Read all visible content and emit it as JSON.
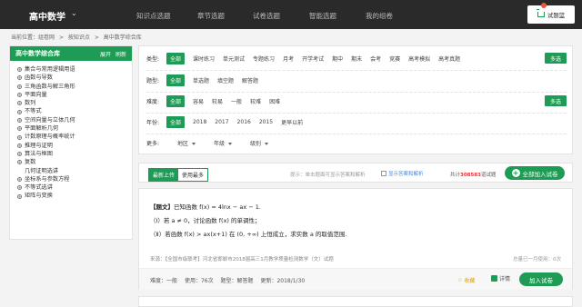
{
  "header": {
    "brand": "高中数学",
    "nav": [
      "知识点选题",
      "章节选题",
      "试卷选题",
      "智能选题",
      "我的组卷"
    ],
    "basket_label": "试题篮"
  },
  "breadcrumb": [
    "当前位置：组卷网",
    ">",
    "按知识点",
    ">",
    "高中数学综合库"
  ],
  "sidebar": {
    "title": "高中数学综合库",
    "expand_label": "展开",
    "refresh_label": "刷新",
    "items": [
      {
        "label": "集合与常用逻辑用语",
        "child": false
      },
      {
        "label": "函数与导数",
        "child": false
      },
      {
        "label": "三角函数与解三角形",
        "child": false
      },
      {
        "label": "平面向量",
        "child": false
      },
      {
        "label": "数列",
        "child": false
      },
      {
        "label": "不等式",
        "child": false
      },
      {
        "label": "空间向量与立体几何",
        "child": false
      },
      {
        "label": "平面解析几何",
        "child": false
      },
      {
        "label": "计数原理与概率统计",
        "child": false
      },
      {
        "label": "推理与证明",
        "child": false
      },
      {
        "label": "算法与框图",
        "child": false
      },
      {
        "label": "复数",
        "child": false
      },
      {
        "label": "几何证明选讲",
        "child": true
      },
      {
        "label": "坐标系与参数方程",
        "child": false
      },
      {
        "label": "不等式选讲",
        "child": false
      },
      {
        "label": "矩阵与变换",
        "child": false
      }
    ]
  },
  "filters": {
    "type": {
      "label": "类型:",
      "options": [
        "全部",
        "课时练习",
        "单元测试",
        "专题练习",
        "月考",
        "开学考试",
        "期中",
        "期末",
        "会考",
        "竞赛",
        "高考模拟",
        "高考真题"
      ]
    },
    "qtype": {
      "label": "题型:",
      "options": [
        "全部",
        "单选题",
        "填空题",
        "解答题"
      ]
    },
    "difficulty": {
      "label": "难度:",
      "options": [
        "全部",
        "容易",
        "较易",
        "一般",
        "较难",
        "困难"
      ]
    },
    "year": {
      "label": "年份:",
      "options": [
        "全部",
        "2018",
        "2017",
        "2016",
        "2015",
        "更早以前"
      ]
    },
    "more": {
      "label": "更多:",
      "dropdowns": [
        "地区",
        "年级",
        "级别"
      ]
    },
    "multi_label": "多选"
  },
  "sortbar": {
    "tabs": [
      "最新上传",
      "使用最多"
    ],
    "hint": "提示：单击题面可显示答案和解析",
    "show_answer": "显示答案和解析",
    "total_prefix": "共计",
    "total_count": "308583",
    "total_suffix": "道试题",
    "add_all": "全部加入试卷"
  },
  "question": {
    "tag": "【题文】",
    "line1": "已知函数 f(x) = 4lnx − ax − 1.",
    "line2": "（Ⅰ）若 a ≠ 0，讨论函数 f(x) 的单调性；",
    "line3": "（Ⅱ）若函数 f(x) > ax(x+1) 在 (0, +∞) 上恒成立，求实数 a 的取值范围.",
    "source": "来源：【全国市级联考】河北省邯郸市2018届高三1月教学质量检测数学（文）试题",
    "usage": "总量已一月使用：0次",
    "difficulty": "难度：一般",
    "used": "使用：76次",
    "qtype": "题型：解答题",
    "updated": "更新：2018/1/30",
    "fav": "收藏",
    "detail": "详情",
    "add": "加入试卷"
  },
  "colors": {
    "accent": "#1e9b54",
    "topbar": "#2a2a2a",
    "highlight": "#e33333"
  }
}
